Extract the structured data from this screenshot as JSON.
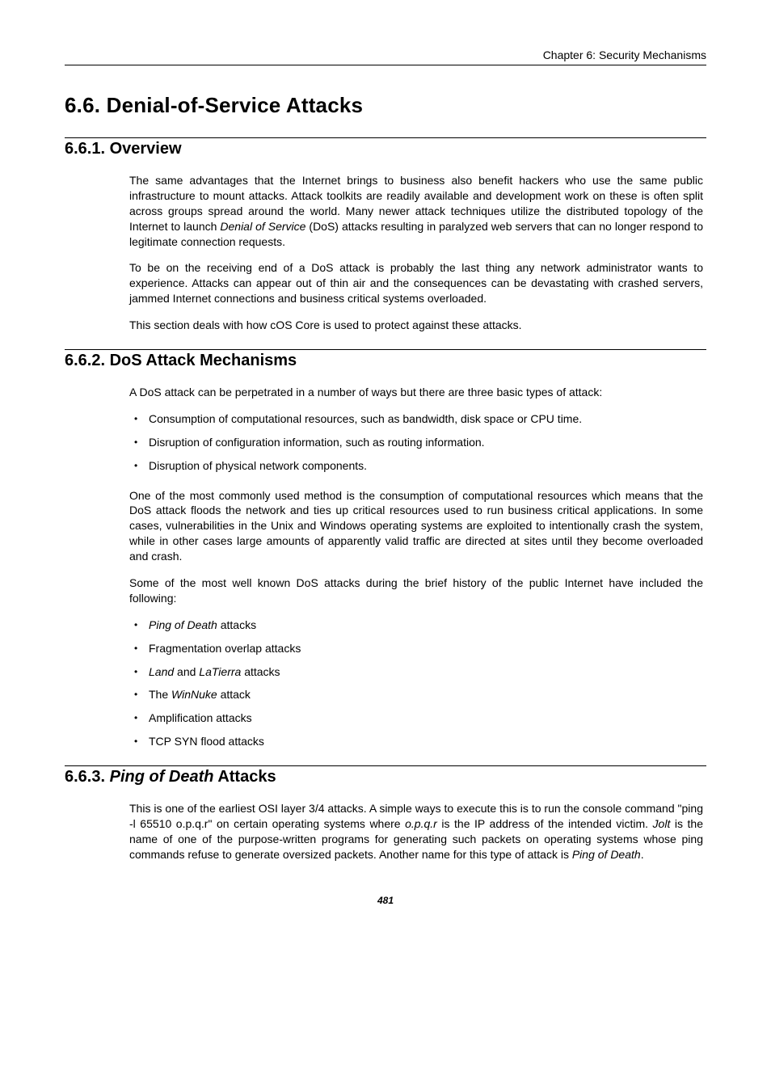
{
  "running_head": "Chapter 6: Security Mechanisms",
  "section_title": "6.6. Denial-of-Service Attacks",
  "sub1": {
    "title": "6.6.1. Overview",
    "p1_a": "The same advantages that the Internet brings to business also benefit hackers who use the same public infrastructure to mount attacks. Attack toolkits are readily available and development work on these is often split across groups spread around the world. Many newer attack techniques utilize the distributed topology of the Internet to launch ",
    "p1_i": "Denial of Service",
    "p1_b": " (DoS) attacks resulting in paralyzed web servers that can no longer respond to legitimate connection requests.",
    "p2": "To be on the receiving end of a DoS attack is probably the last thing any network administrator wants to experience. Attacks can appear out of thin air and the consequences can be devastating with crashed servers, jammed Internet connections and business critical systems overloaded.",
    "p3": "This section deals with how cOS Core is used to protect against these attacks."
  },
  "sub2": {
    "title": "6.6.2. DoS Attack Mechanisms",
    "p1": "A DoS attack can be perpetrated in a number of ways but there are three basic types of attack:",
    "bullets1": [
      "Consumption of computational resources, such as bandwidth, disk space or CPU time.",
      "Disruption of configuration information, such as routing information.",
      "Disruption of physical network components."
    ],
    "p2": "One of the most commonly used method is the consumption of computational resources which means that the DoS attack floods the network and ties up critical resources used to run business critical applications. In some cases, vulnerabilities in the Unix and Windows operating systems are exploited to intentionally crash the system, while in other cases large amounts of apparently valid traffic are directed at sites until they become overloaded and crash.",
    "p3": "Some of the most well known DoS attacks during the brief history of the public Internet have included the following:",
    "b2_li1_i": "Ping of Death",
    "b2_li1_r": " attacks",
    "b2_li2": "Fragmentation overlap attacks",
    "b2_li3_i1": "Land",
    "b2_li3_m": " and ",
    "b2_li3_i2": "LaTierra",
    "b2_li3_r": "  attacks",
    "b2_li4_l": "The ",
    "b2_li4_i": "WinNuke",
    "b2_li4_r": " attack",
    "b2_li5": "Amplification attacks",
    "b2_li6": "TCP SYN flood attacks"
  },
  "sub3": {
    "title_prefix": "6.6.3. ",
    "title_italic": "Ping of Death",
    "title_suffix": " Attacks",
    "p1_a": "This is one of the earliest OSI layer 3/4 attacks. A simple ways to execute this is to run the console command \"ping -l 65510 o.p.q.r\" on certain operating systems where ",
    "p1_i1": "o.p.q.r",
    "p1_b": " is the IP address of the intended victim. ",
    "p1_i2": "Jolt",
    "p1_c": " is the name of one of the purpose-written programs for generating such packets on operating systems whose ping commands refuse to generate oversized packets. Another name for this type of attack is ",
    "p1_i3": "Ping of Death",
    "p1_d": "."
  },
  "page_number": "481"
}
